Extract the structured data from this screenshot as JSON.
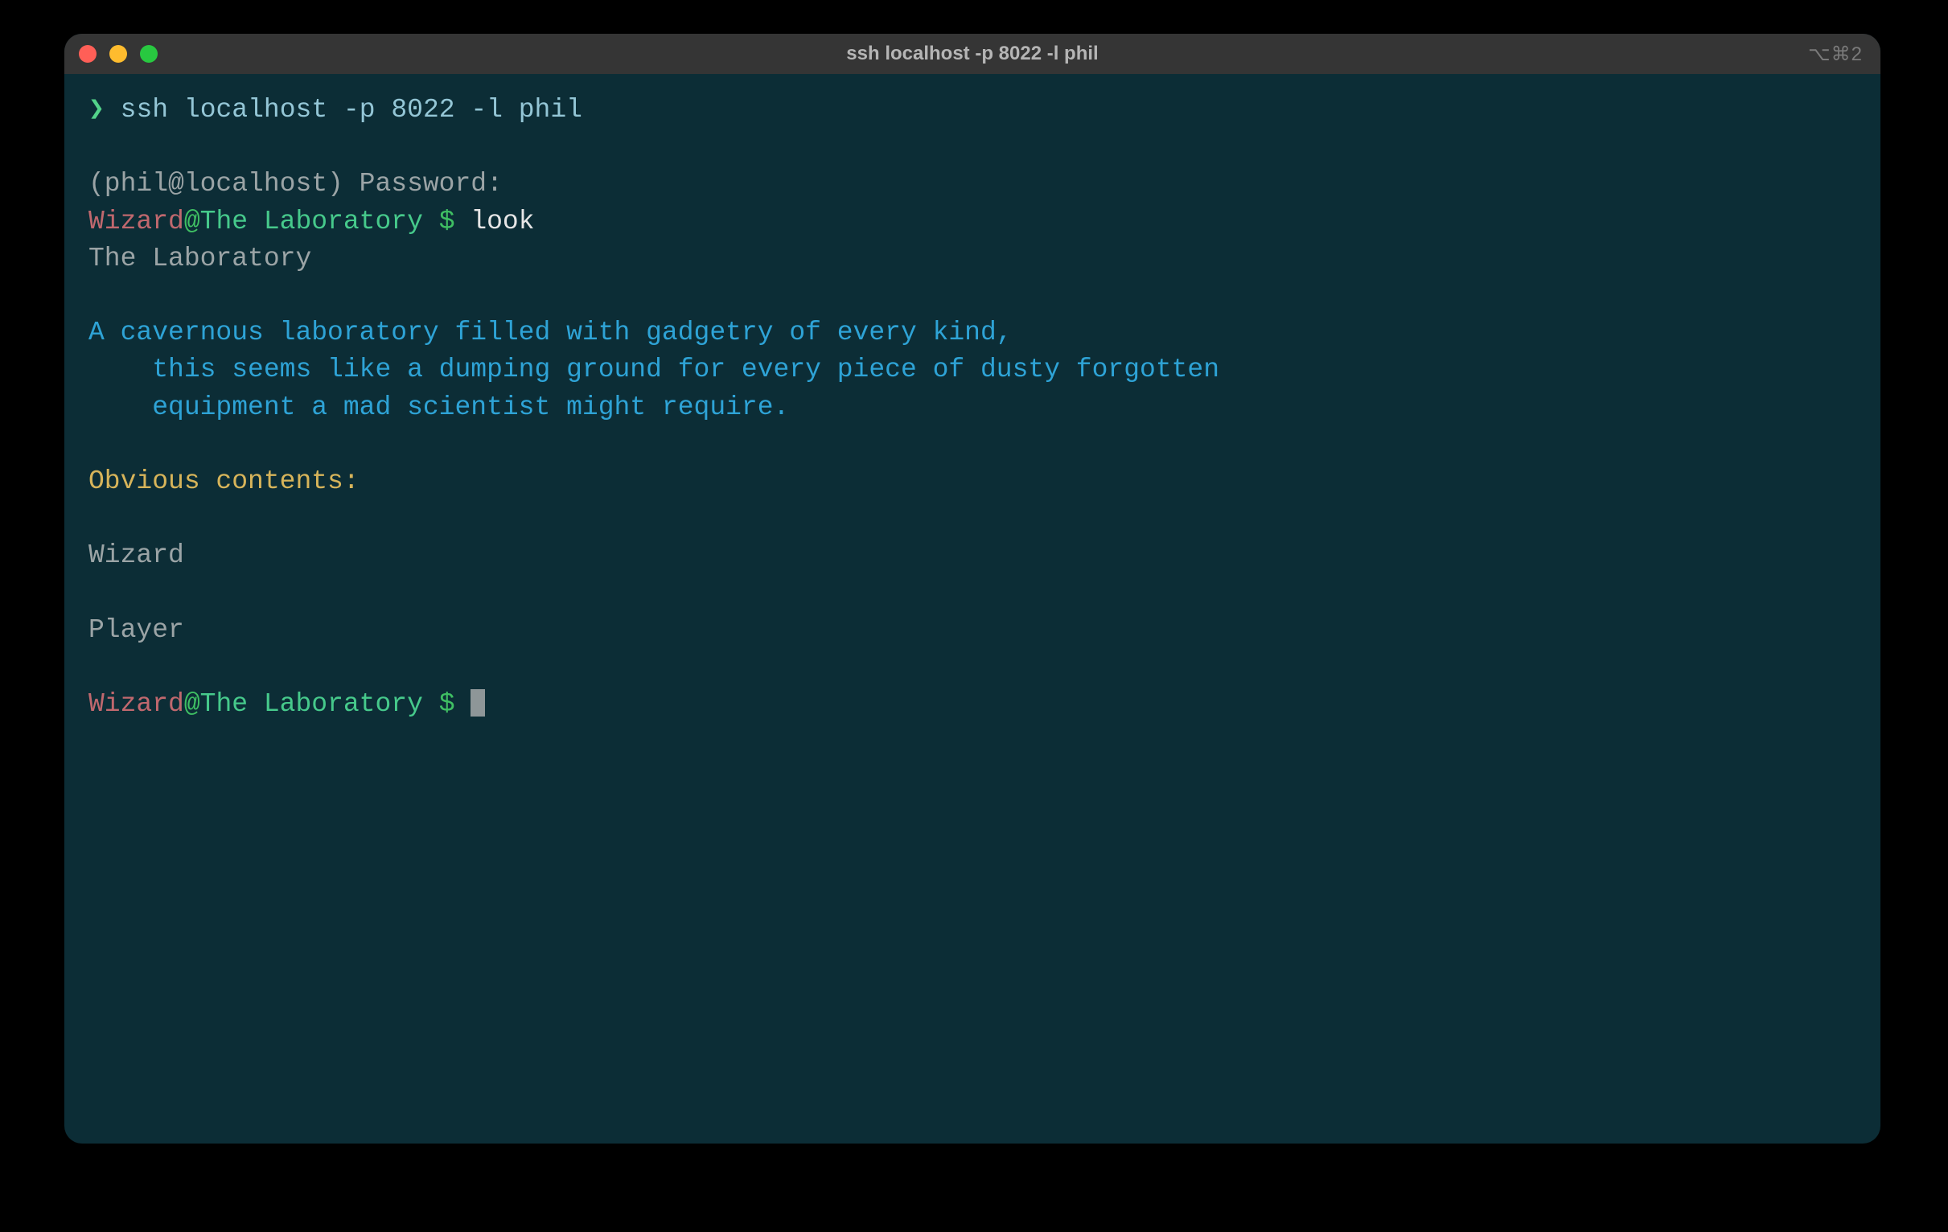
{
  "titlebar": {
    "title": "ssh localhost -p 8022 -l phil",
    "right_indicator": "⌥⌘2"
  },
  "shell": {
    "prompt_glyph": "❯",
    "ssh_cmd": " ssh localhost -p 8022 -l phil",
    "password_line": "(phil@localhost) Password:"
  },
  "mud": {
    "prompt": {
      "user": "Wizard",
      "at": "@",
      "location": "The Laboratory ",
      "dollar": "$"
    },
    "cmd_look": " look",
    "room_name": "The Laboratory",
    "desc_line1": "A cavernous laboratory filled with gadgetry of every kind,",
    "desc_line2": "    this seems like a dumping ground for every piece of dusty forgotten",
    "desc_line3": "    equipment a mad scientist might require.",
    "contents_header": "Obvious contents:",
    "contents": {
      "a": "Wizard",
      "b": "Player"
    }
  }
}
